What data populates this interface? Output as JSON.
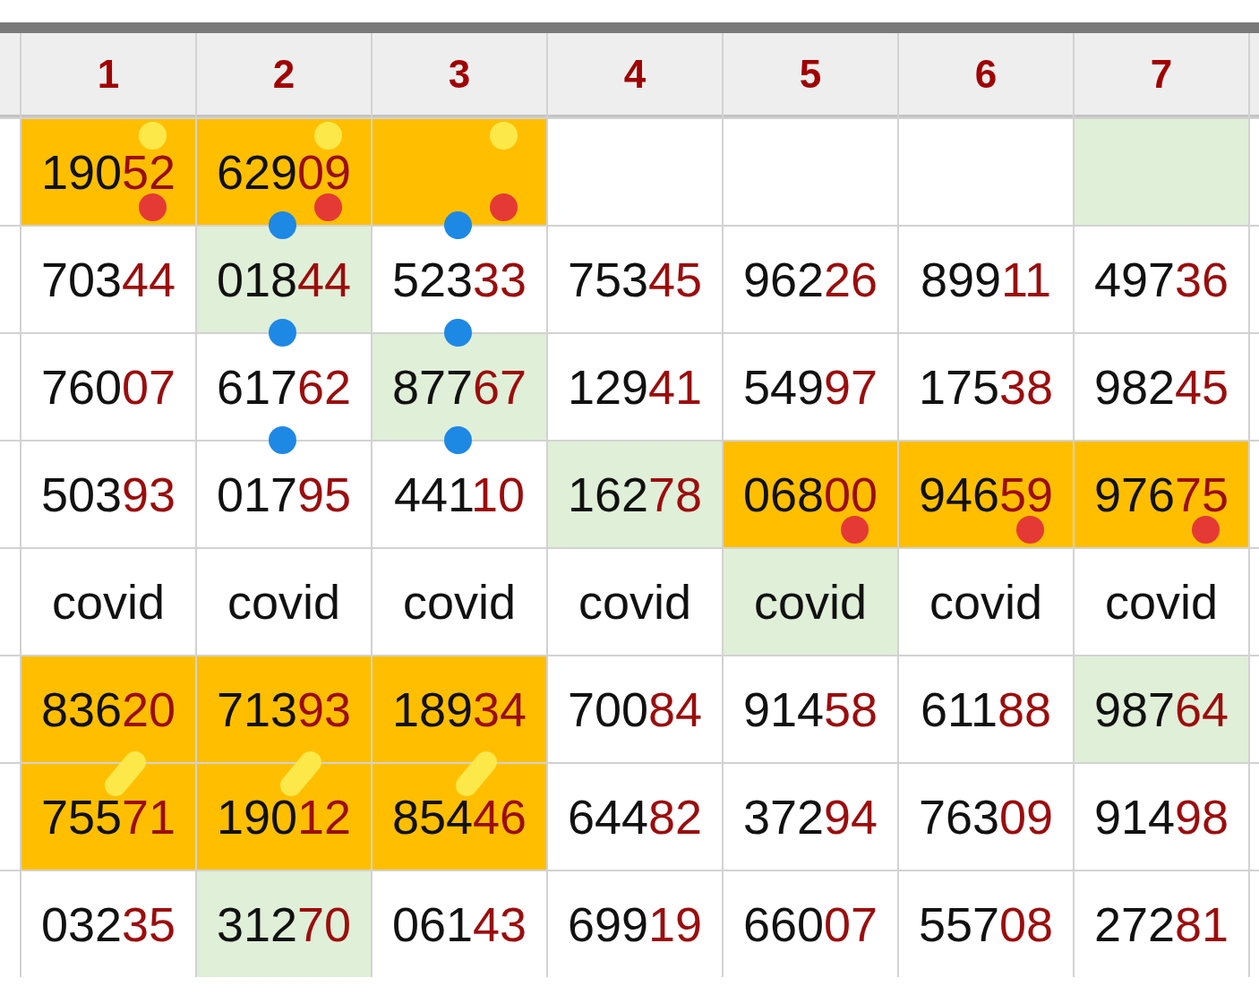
{
  "table": {
    "columns": [
      "1",
      "2",
      "3",
      "4",
      "5",
      "6",
      "7"
    ],
    "rows": [
      {
        "cells": [
          {
            "kind": "number",
            "value": "19052",
            "color": "#ffbf00",
            "markers": [
              {
                "kind": "top-dot",
                "color": "#fde84a"
              },
              {
                "kind": "bottom-dot",
                "color": "#e53935"
              }
            ]
          },
          {
            "kind": "number",
            "value": "62909",
            "color": "#ffbf00",
            "markers": [
              {
                "kind": "top-dot",
                "color": "#fde84a"
              },
              {
                "kind": "bottom-dot",
                "color": "#e53935"
              },
              {
                "kind": "edge-dot",
                "color": "#1e88e5"
              }
            ]
          },
          {
            "kind": "empty",
            "color": "#ffbf00",
            "markers": [
              {
                "kind": "top-dot",
                "color": "#fde84a"
              },
              {
                "kind": "bottom-dot",
                "color": "#e53935"
              },
              {
                "kind": "edge-dot",
                "color": "#1e88e5"
              }
            ]
          },
          {
            "kind": "empty"
          },
          {
            "kind": "empty"
          },
          {
            "kind": "empty"
          },
          {
            "kind": "empty",
            "color": "#e0efd8"
          }
        ]
      },
      {
        "cells": [
          {
            "kind": "number",
            "value": "70344"
          },
          {
            "kind": "number",
            "value": "01844",
            "color": "#e0efd8",
            "markers": [
              {
                "kind": "edge-dot",
                "color": "#1e88e5"
              }
            ]
          },
          {
            "kind": "number",
            "value": "52333",
            "markers": [
              {
                "kind": "edge-dot",
                "color": "#1e88e5"
              }
            ]
          },
          {
            "kind": "number",
            "value": "75345"
          },
          {
            "kind": "number",
            "value": "96226"
          },
          {
            "kind": "number",
            "value": "89911"
          },
          {
            "kind": "number",
            "value": "49736"
          }
        ]
      },
      {
        "cells": [
          {
            "kind": "number",
            "value": "76007"
          },
          {
            "kind": "number",
            "value": "61762",
            "markers": [
              {
                "kind": "edge-dot",
                "color": "#1e88e5"
              }
            ]
          },
          {
            "kind": "number",
            "value": "87767",
            "color": "#e0efd8",
            "markers": [
              {
                "kind": "edge-dot",
                "color": "#1e88e5"
              }
            ]
          },
          {
            "kind": "number",
            "value": "12941"
          },
          {
            "kind": "number",
            "value": "54997"
          },
          {
            "kind": "number",
            "value": "17538"
          },
          {
            "kind": "number",
            "value": "98245"
          }
        ]
      },
      {
        "cells": [
          {
            "kind": "number",
            "value": "50393"
          },
          {
            "kind": "number",
            "value": "01795"
          },
          {
            "kind": "number",
            "value": "44110"
          },
          {
            "kind": "number",
            "value": "16278",
            "color": "#e0efd8"
          },
          {
            "kind": "number",
            "value": "06800",
            "color": "#ffbf00",
            "markers": [
              {
                "kind": "bottom-dot",
                "color": "#e53935"
              }
            ]
          },
          {
            "kind": "number",
            "value": "94659",
            "color": "#ffbf00",
            "markers": [
              {
                "kind": "bottom-dot",
                "color": "#e53935"
              }
            ]
          },
          {
            "kind": "number",
            "value": "97675",
            "color": "#ffbf00",
            "markers": [
              {
                "kind": "bottom-dot",
                "color": "#e53935"
              }
            ]
          }
        ]
      },
      {
        "cells": [
          {
            "kind": "text",
            "value": "covid"
          },
          {
            "kind": "text",
            "value": "covid"
          },
          {
            "kind": "text",
            "value": "covid"
          },
          {
            "kind": "text",
            "value": "covid"
          },
          {
            "kind": "text",
            "value": "covid",
            "color": "#e0efd8"
          },
          {
            "kind": "text",
            "value": "covid"
          },
          {
            "kind": "text",
            "value": "covid"
          }
        ]
      },
      {
        "cells": [
          {
            "kind": "number",
            "value": "83620",
            "color": "#ffbf00",
            "markers": [
              {
                "kind": "edge-capsule",
                "color": "#fde84a"
              }
            ]
          },
          {
            "kind": "number",
            "value": "71393",
            "color": "#ffbf00",
            "markers": [
              {
                "kind": "edge-capsule",
                "color": "#fde84a"
              }
            ]
          },
          {
            "kind": "number",
            "value": "18934",
            "color": "#ffbf00",
            "markers": [
              {
                "kind": "edge-capsule",
                "color": "#fde84a"
              }
            ]
          },
          {
            "kind": "number",
            "value": "70084"
          },
          {
            "kind": "number",
            "value": "91458"
          },
          {
            "kind": "number",
            "value": "61188"
          },
          {
            "kind": "number",
            "value": "98764",
            "color": "#e0efd8"
          }
        ]
      },
      {
        "cells": [
          {
            "kind": "number",
            "value": "75571",
            "color": "#ffbf00"
          },
          {
            "kind": "number",
            "value": "19012",
            "color": "#ffbf00"
          },
          {
            "kind": "number",
            "value": "85446",
            "color": "#ffbf00"
          },
          {
            "kind": "number",
            "value": "64482"
          },
          {
            "kind": "number",
            "value": "37294"
          },
          {
            "kind": "number",
            "value": "76309"
          },
          {
            "kind": "number",
            "value": "91498"
          }
        ]
      },
      {
        "cells": [
          {
            "kind": "number",
            "value": "03235"
          },
          {
            "kind": "number",
            "value": "31270",
            "color": "#e0efd8"
          },
          {
            "kind": "number",
            "value": "06143"
          },
          {
            "kind": "number",
            "value": "69919"
          },
          {
            "kind": "number",
            "value": "66007"
          },
          {
            "kind": "number",
            "value": "55708"
          },
          {
            "kind": "number",
            "value": "27281"
          }
        ]
      }
    ]
  }
}
